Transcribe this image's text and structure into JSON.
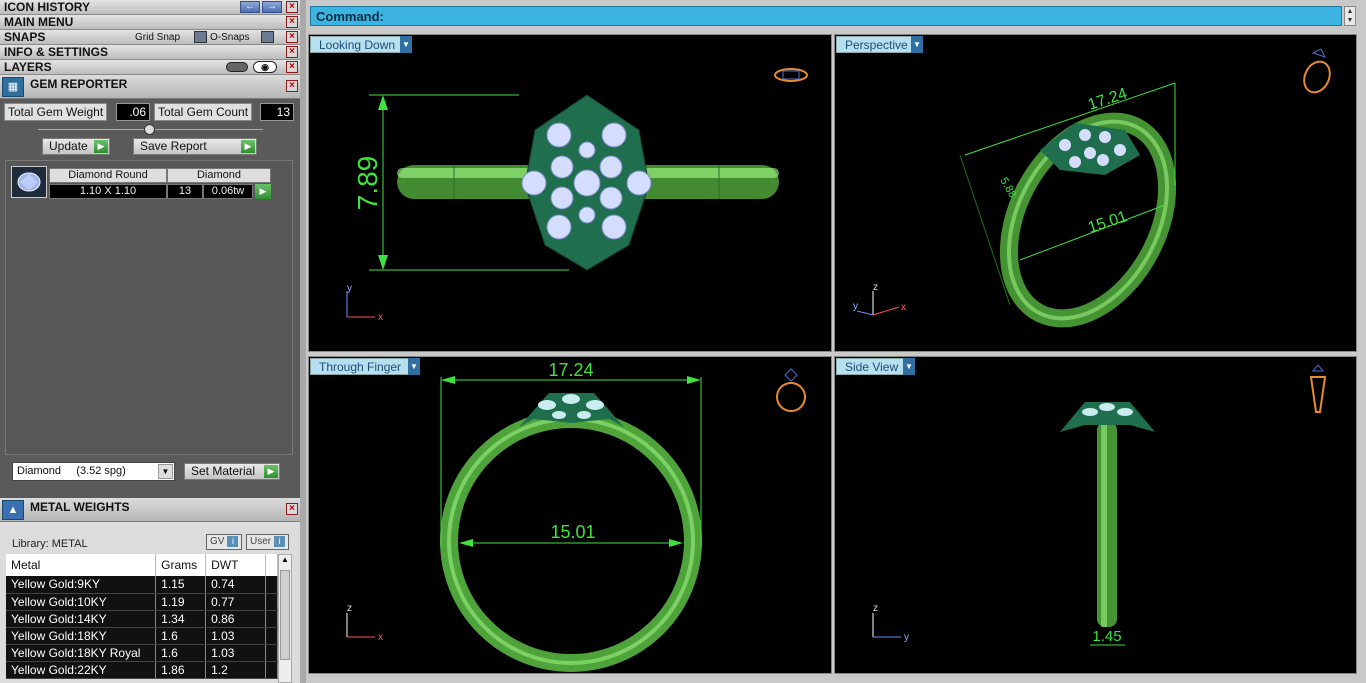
{
  "left_panel": {
    "headers": {
      "icon_history": "ICON HISTORY",
      "main_menu": "MAIN MENU",
      "snaps": "SNAPS",
      "grid_snap": "Grid Snap",
      "o_snaps": "O-Snaps",
      "info_settings": "INFO & SETTINGS",
      "layers": "LAYERS"
    },
    "gem_reporter": {
      "title": "GEM REPORTER",
      "total_weight_label": "Total Gem Weight",
      "total_weight_value": ".06",
      "total_count_label": "Total Gem Count",
      "total_count_value": "13",
      "update_label": "Update",
      "save_report_label": "Save Report",
      "gem": {
        "shape": "Diamond Round",
        "material": "Diamond",
        "size": "1.10 X 1.10",
        "count": "13",
        "weight": "0.06tw"
      },
      "material_select": "Diamond     (3.52 spg)",
      "set_material_label": "Set Material"
    },
    "metal_weights": {
      "title": "METAL WEIGHTS",
      "library": "Library: METAL",
      "gv_label": "GV",
      "user_label": "User",
      "columns": [
        "Metal",
        "Grams",
        "DWT"
      ],
      "rows": [
        [
          "Yellow Gold:9KY",
          "1.15",
          "0.74"
        ],
        [
          "Yellow Gold:10KY",
          "1.19",
          "0.77"
        ],
        [
          "Yellow Gold:14KY",
          "1.34",
          "0.86"
        ],
        [
          "Yellow Gold:18KY",
          "1.6",
          "1.03"
        ],
        [
          "Yellow Gold:18KY Royal",
          "1.6",
          "1.03"
        ],
        [
          "Yellow Gold:22KY",
          "1.86",
          "1.2"
        ]
      ]
    }
  },
  "command": {
    "label": "Command:"
  },
  "viewports": {
    "top": {
      "label": "Looking Down",
      "dimension": "7.89",
      "axis_y": "y",
      "axis_x": "x"
    },
    "perspective": {
      "label": "Perspective",
      "dim_width": "17.24",
      "dim_inner": "15.01",
      "dim_small": "5.88",
      "axis_z": "z",
      "axis_y": "y",
      "axis_x": "x"
    },
    "front": {
      "label": "Through Finger",
      "dim_width": "17.24",
      "dim_inner": "15.01",
      "axis_z": "z",
      "axis_x": "x"
    },
    "side": {
      "label": "Side View",
      "dim_band": "1.45",
      "axis_z": "z",
      "axis_y": "y"
    }
  },
  "colors": {
    "metal_green": "#7dff5a",
    "dimension_green": "#3ee23e",
    "gem_blue": "#c9d9ff",
    "head_green": "#1f6e4e",
    "command_bar": "#3cb4e0"
  }
}
